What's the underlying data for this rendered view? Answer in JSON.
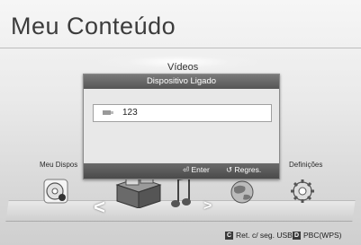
{
  "page": {
    "title": "Meu Conteúdo"
  },
  "categories": {
    "center": "Vídeos",
    "left": "Meu Dispos",
    "right": "Definições"
  },
  "dialog": {
    "title": "Dispositivo Ligado",
    "devices": [
      {
        "name": "123",
        "icon": "usb-drive-icon"
      }
    ],
    "enter_label": "Enter",
    "return_label": "Regres."
  },
  "legend": [
    {
      "key": "C",
      "label": "Ret. c/ seg. USB"
    },
    {
      "key": "D",
      "label": "PBC(WPS)"
    }
  ],
  "icons": [
    "disc-icon",
    "photo-box-icon",
    "music-note-icon",
    "globe-icon",
    "gear-icon"
  ],
  "colors": {
    "dialog_header": "#555555",
    "dialog_footer": "#4a4a4a",
    "background": "#e6e6e6"
  }
}
